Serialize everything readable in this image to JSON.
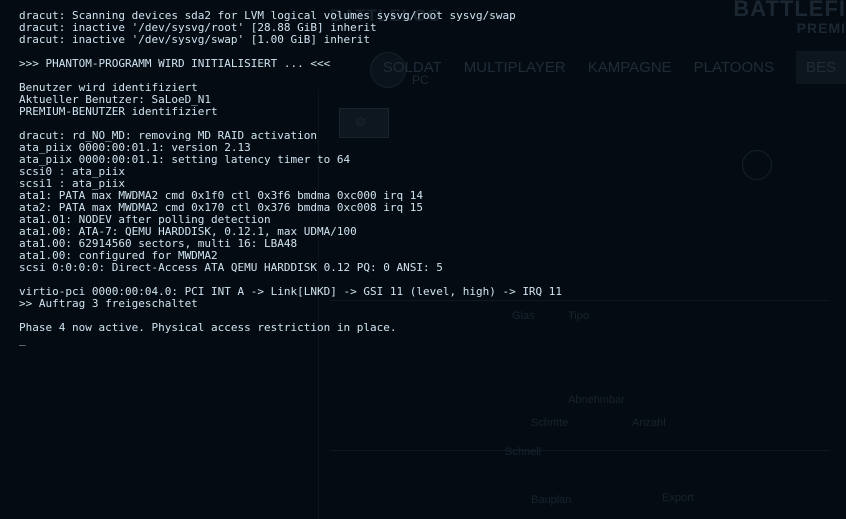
{
  "background": {
    "logo": "BATTLELOG",
    "brand": "BATTLEFI",
    "brand_sub": "PREMI",
    "platform": "PC",
    "nav": [
      "SOLDAT",
      "MULTIPLAYER",
      "KAMPAGNE",
      "PLATOONS",
      "BES"
    ],
    "fragments": [
      "Glas",
      "Tipo",
      "Abnehmbar",
      "Schritte",
      "Anzahl",
      "Schnell",
      "Bauplan",
      "Export"
    ]
  },
  "terminal": {
    "lines": [
      "dracut: Scanning devices sda2 for LVM logical volumes sysvg/root sysvg/swap",
      "dracut: inactive '/dev/sysvg/root' [28.88 GiB] inherit",
      "dracut: inactive '/dev/sysvg/swap' [1.00 GiB] inherit",
      "",
      ">>> PHANTOM-PROGRAMM WIRD INITIALISIERT ... <<<",
      "",
      "Benutzer wird identifiziert",
      "Aktueller Benutzer: SaLoeD_N1",
      "PREMIUM-BENUTZER identifiziert",
      "",
      "dracut: rd_NO_MD: removing MD RAID activation",
      "ata_piix 0000:00:01.1: version 2.13",
      "ata_piix 0000:00:01.1: setting latency timer to 64",
      "scsi0 : ata_piix",
      "scsi1 : ata_piix",
      "ata1: PATA max MWDMA2 cmd 0x1f0 ctl 0x3f6 bmdma 0xc000 irq 14",
      "ata2: PATA max MWDMA2 cmd 0x170 ctl 0x376 bmdma 0xc008 irq 15",
      "ata1.01: NODEV after polling detection",
      "ata1.00: ATA-7: QEMU HARDDISK, 0.12.1, max UDMA/100",
      "ata1.00: 62914560 sectors, multi 16: LBA48",
      "ata1.00: configured for MWDMA2",
      "scsi 0:0:0:0: Direct-Access ATA QEMU HARDDISK 0.12 PQ: 0 ANSI: 5",
      "",
      "virtio-pci 0000:00:04.0: PCI INT A -> Link[LNKD] -> GSI 11 (level, high) -> IRQ 11",
      ">> Auftrag 3 freigeschaltet",
      "",
      "Phase 4 now active. Physical access restriction in place."
    ]
  }
}
